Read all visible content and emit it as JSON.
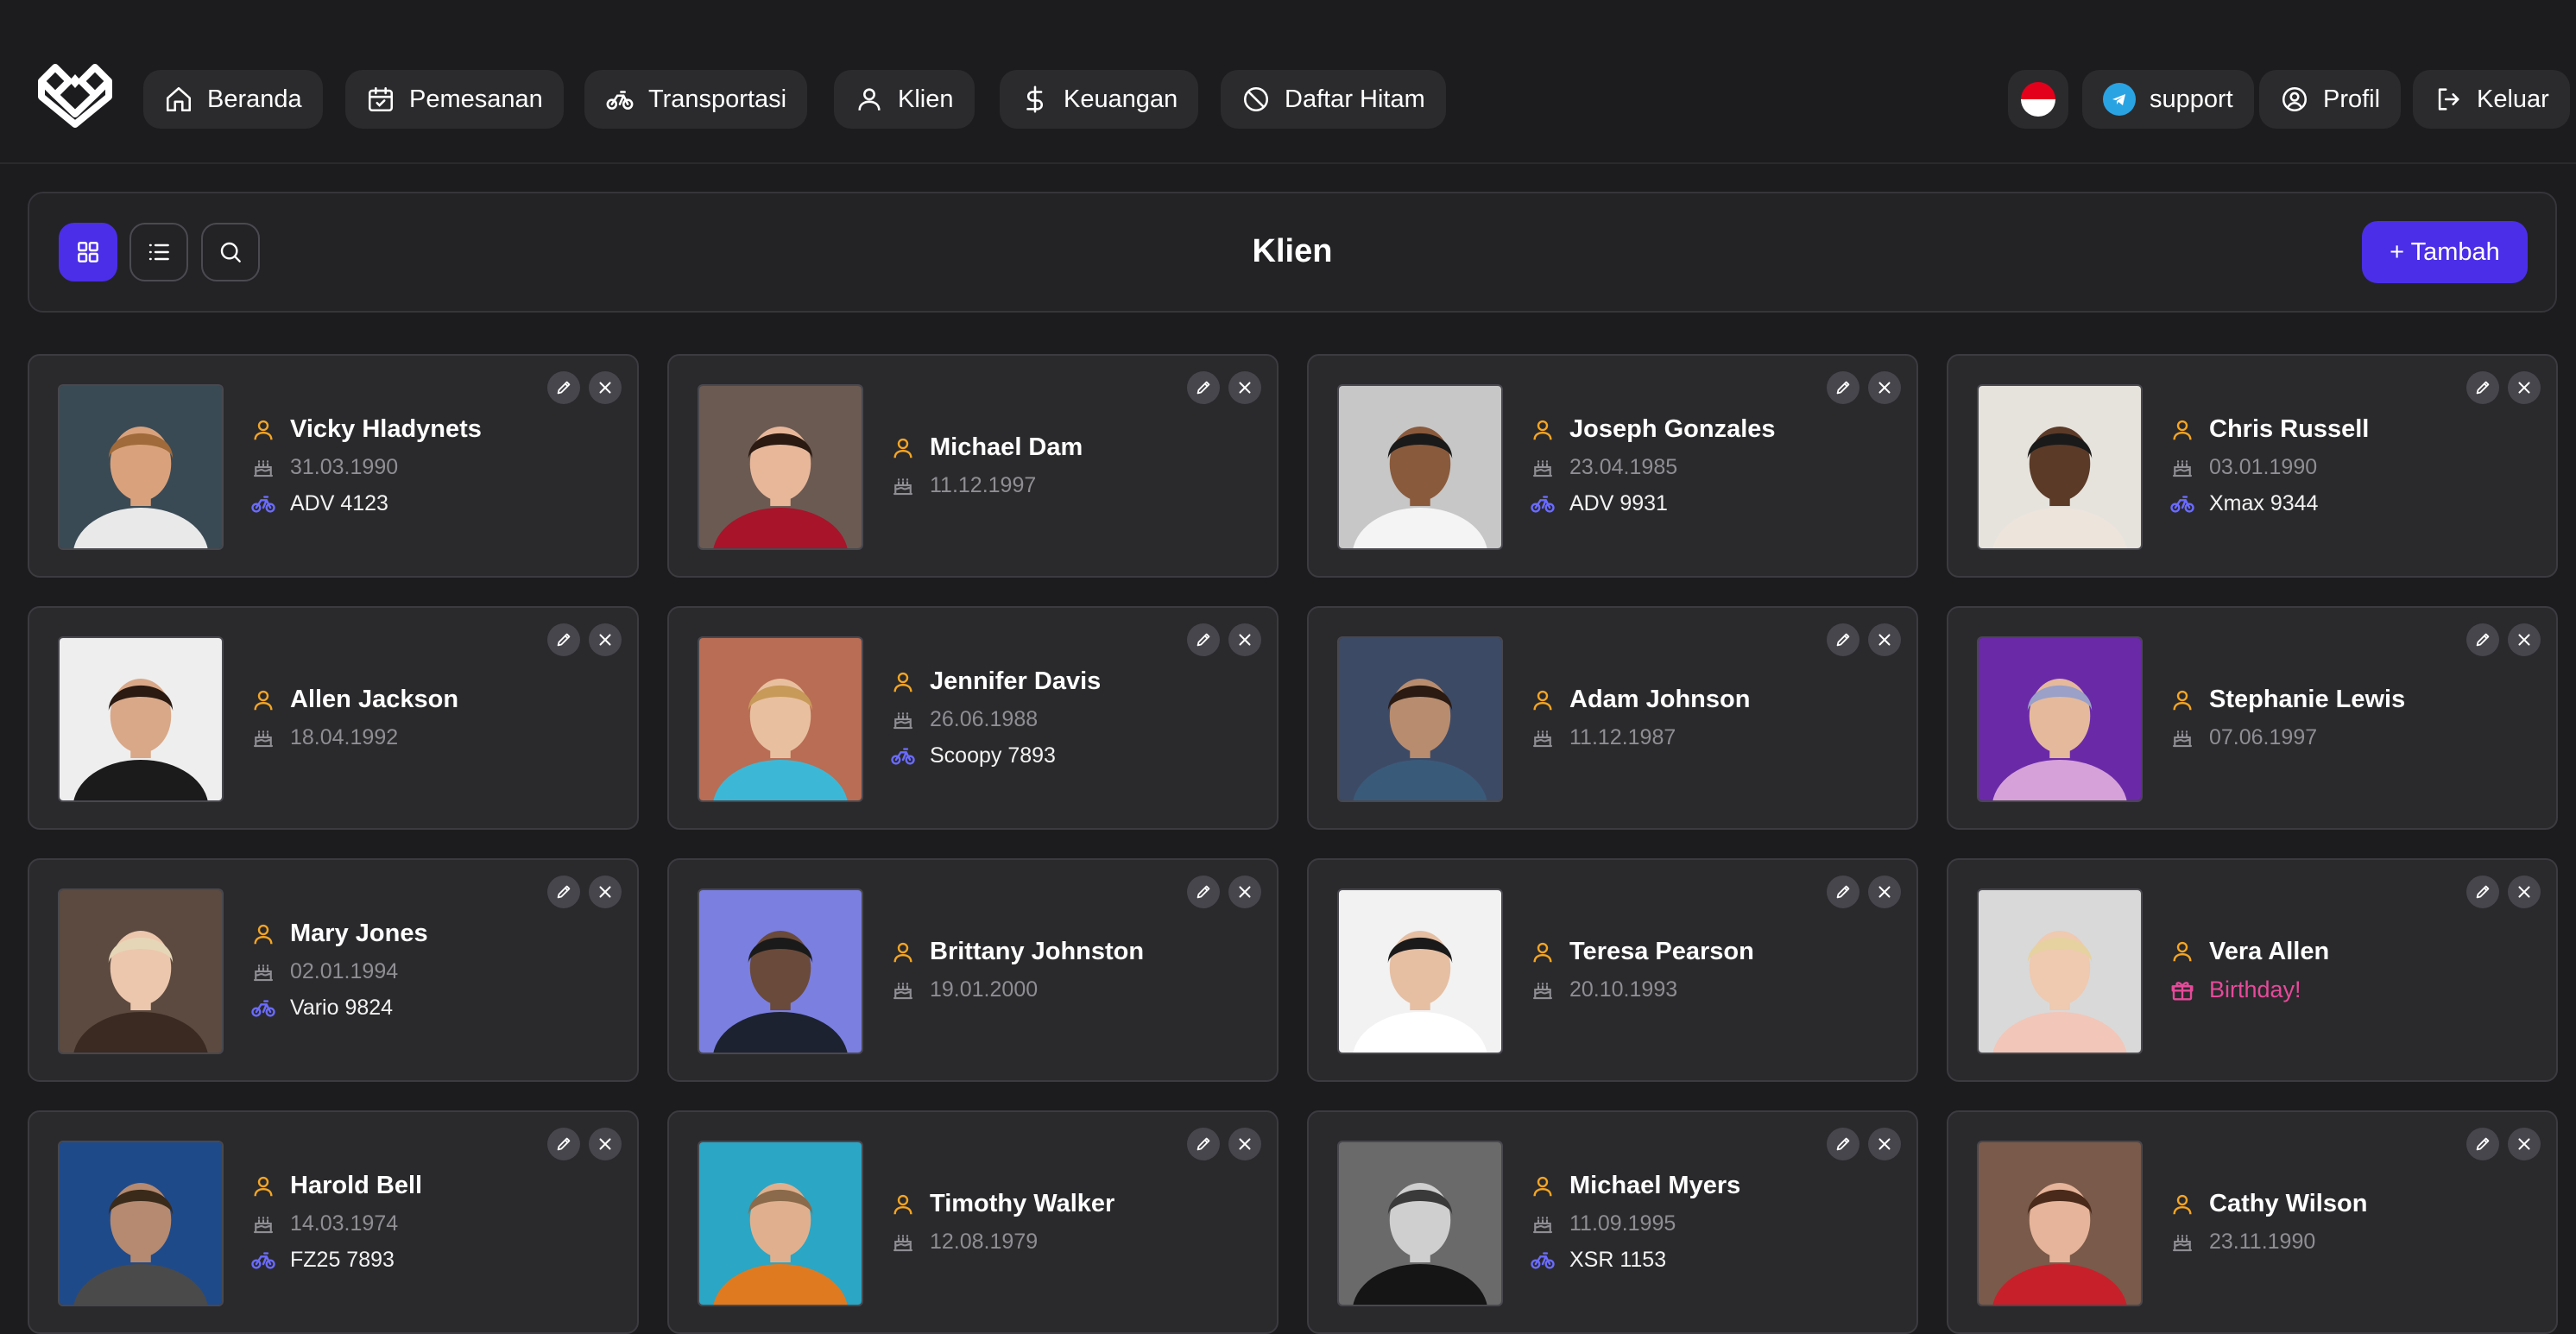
{
  "nav": {
    "items": [
      {
        "label": "Beranda",
        "icon": "home-icon"
      },
      {
        "label": "Pemesanan",
        "icon": "calendar-icon"
      },
      {
        "label": "Transportasi",
        "icon": "bike-icon"
      },
      {
        "label": "Klien",
        "icon": "user-icon"
      },
      {
        "label": "Keuangan",
        "icon": "dollar-icon"
      },
      {
        "label": "Daftar Hitam",
        "icon": "ban-icon"
      }
    ],
    "support_label": "support",
    "profile_label": "Profil",
    "logout_label": "Keluar"
  },
  "toolbar": {
    "title": "Klien",
    "add_label": "+ Tambah"
  },
  "colors": {
    "accent": "#4b2ee8",
    "user_icon": "#f5a623",
    "vehicle_icon": "#6b6bff",
    "birthday": "#e64a9a",
    "background": "#1c1c1e",
    "card": "#2a2a2d"
  },
  "clients": [
    {
      "name": "Vicky Hladynets",
      "dob": "31.03.1990",
      "vehicle": "ADV 4123"
    },
    {
      "name": "Michael Dam",
      "dob": "11.12.1997"
    },
    {
      "name": "Joseph Gonzales",
      "dob": "23.04.1985",
      "vehicle": "ADV 9931"
    },
    {
      "name": "Chris Russell",
      "dob": "03.01.1990",
      "vehicle": "Xmax 9344"
    },
    {
      "name": "Allen Jackson",
      "dob": "18.04.1992"
    },
    {
      "name": "Jennifer Davis",
      "dob": "26.06.1988",
      "vehicle": "Scoopy 7893"
    },
    {
      "name": "Adam Johnson",
      "dob": "11.12.1987"
    },
    {
      "name": "Stephanie Lewis",
      "dob": "07.06.1997"
    },
    {
      "name": "Mary Jones",
      "dob": "02.01.1994",
      "vehicle": "Vario 9824"
    },
    {
      "name": "Brittany Johnston",
      "dob": "19.01.2000"
    },
    {
      "name": "Teresa Pearson",
      "dob": "20.10.1993"
    },
    {
      "name": "Vera Allen",
      "birthday": "Birthday!"
    },
    {
      "name": "Harold Bell",
      "dob": "14.03.1974",
      "vehicle": "FZ25 7893"
    },
    {
      "name": "Timothy Walker",
      "dob": "12.08.1979"
    },
    {
      "name": "Michael Myers",
      "dob": "11.09.1995",
      "vehicle": "XSR 1153"
    },
    {
      "name": "Cathy Wilson",
      "dob": "23.11.1990"
    }
  ]
}
